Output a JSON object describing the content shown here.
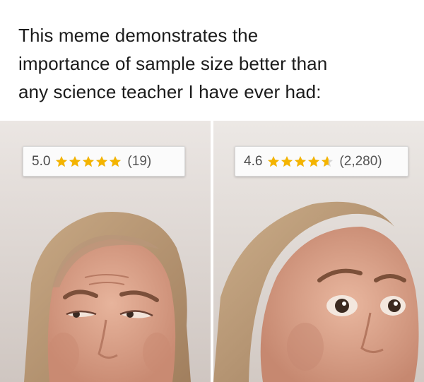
{
  "caption": {
    "lines": [
      "This meme demonstrates the",
      "importance of sample size better than",
      "any science teacher I have ever had:"
    ]
  },
  "colors": {
    "star": "#f4b400",
    "star_empty": "#d6d6d6",
    "text": "#1b1b1b",
    "rating_text": "#555555"
  },
  "panels": [
    {
      "rating": {
        "score": "5.0",
        "stars": 5.0,
        "count": "(19)"
      },
      "expression": "skeptical"
    },
    {
      "rating": {
        "score": "4.6",
        "stars": 4.6,
        "count": "(2,280)"
      },
      "expression": "trusting"
    }
  ]
}
